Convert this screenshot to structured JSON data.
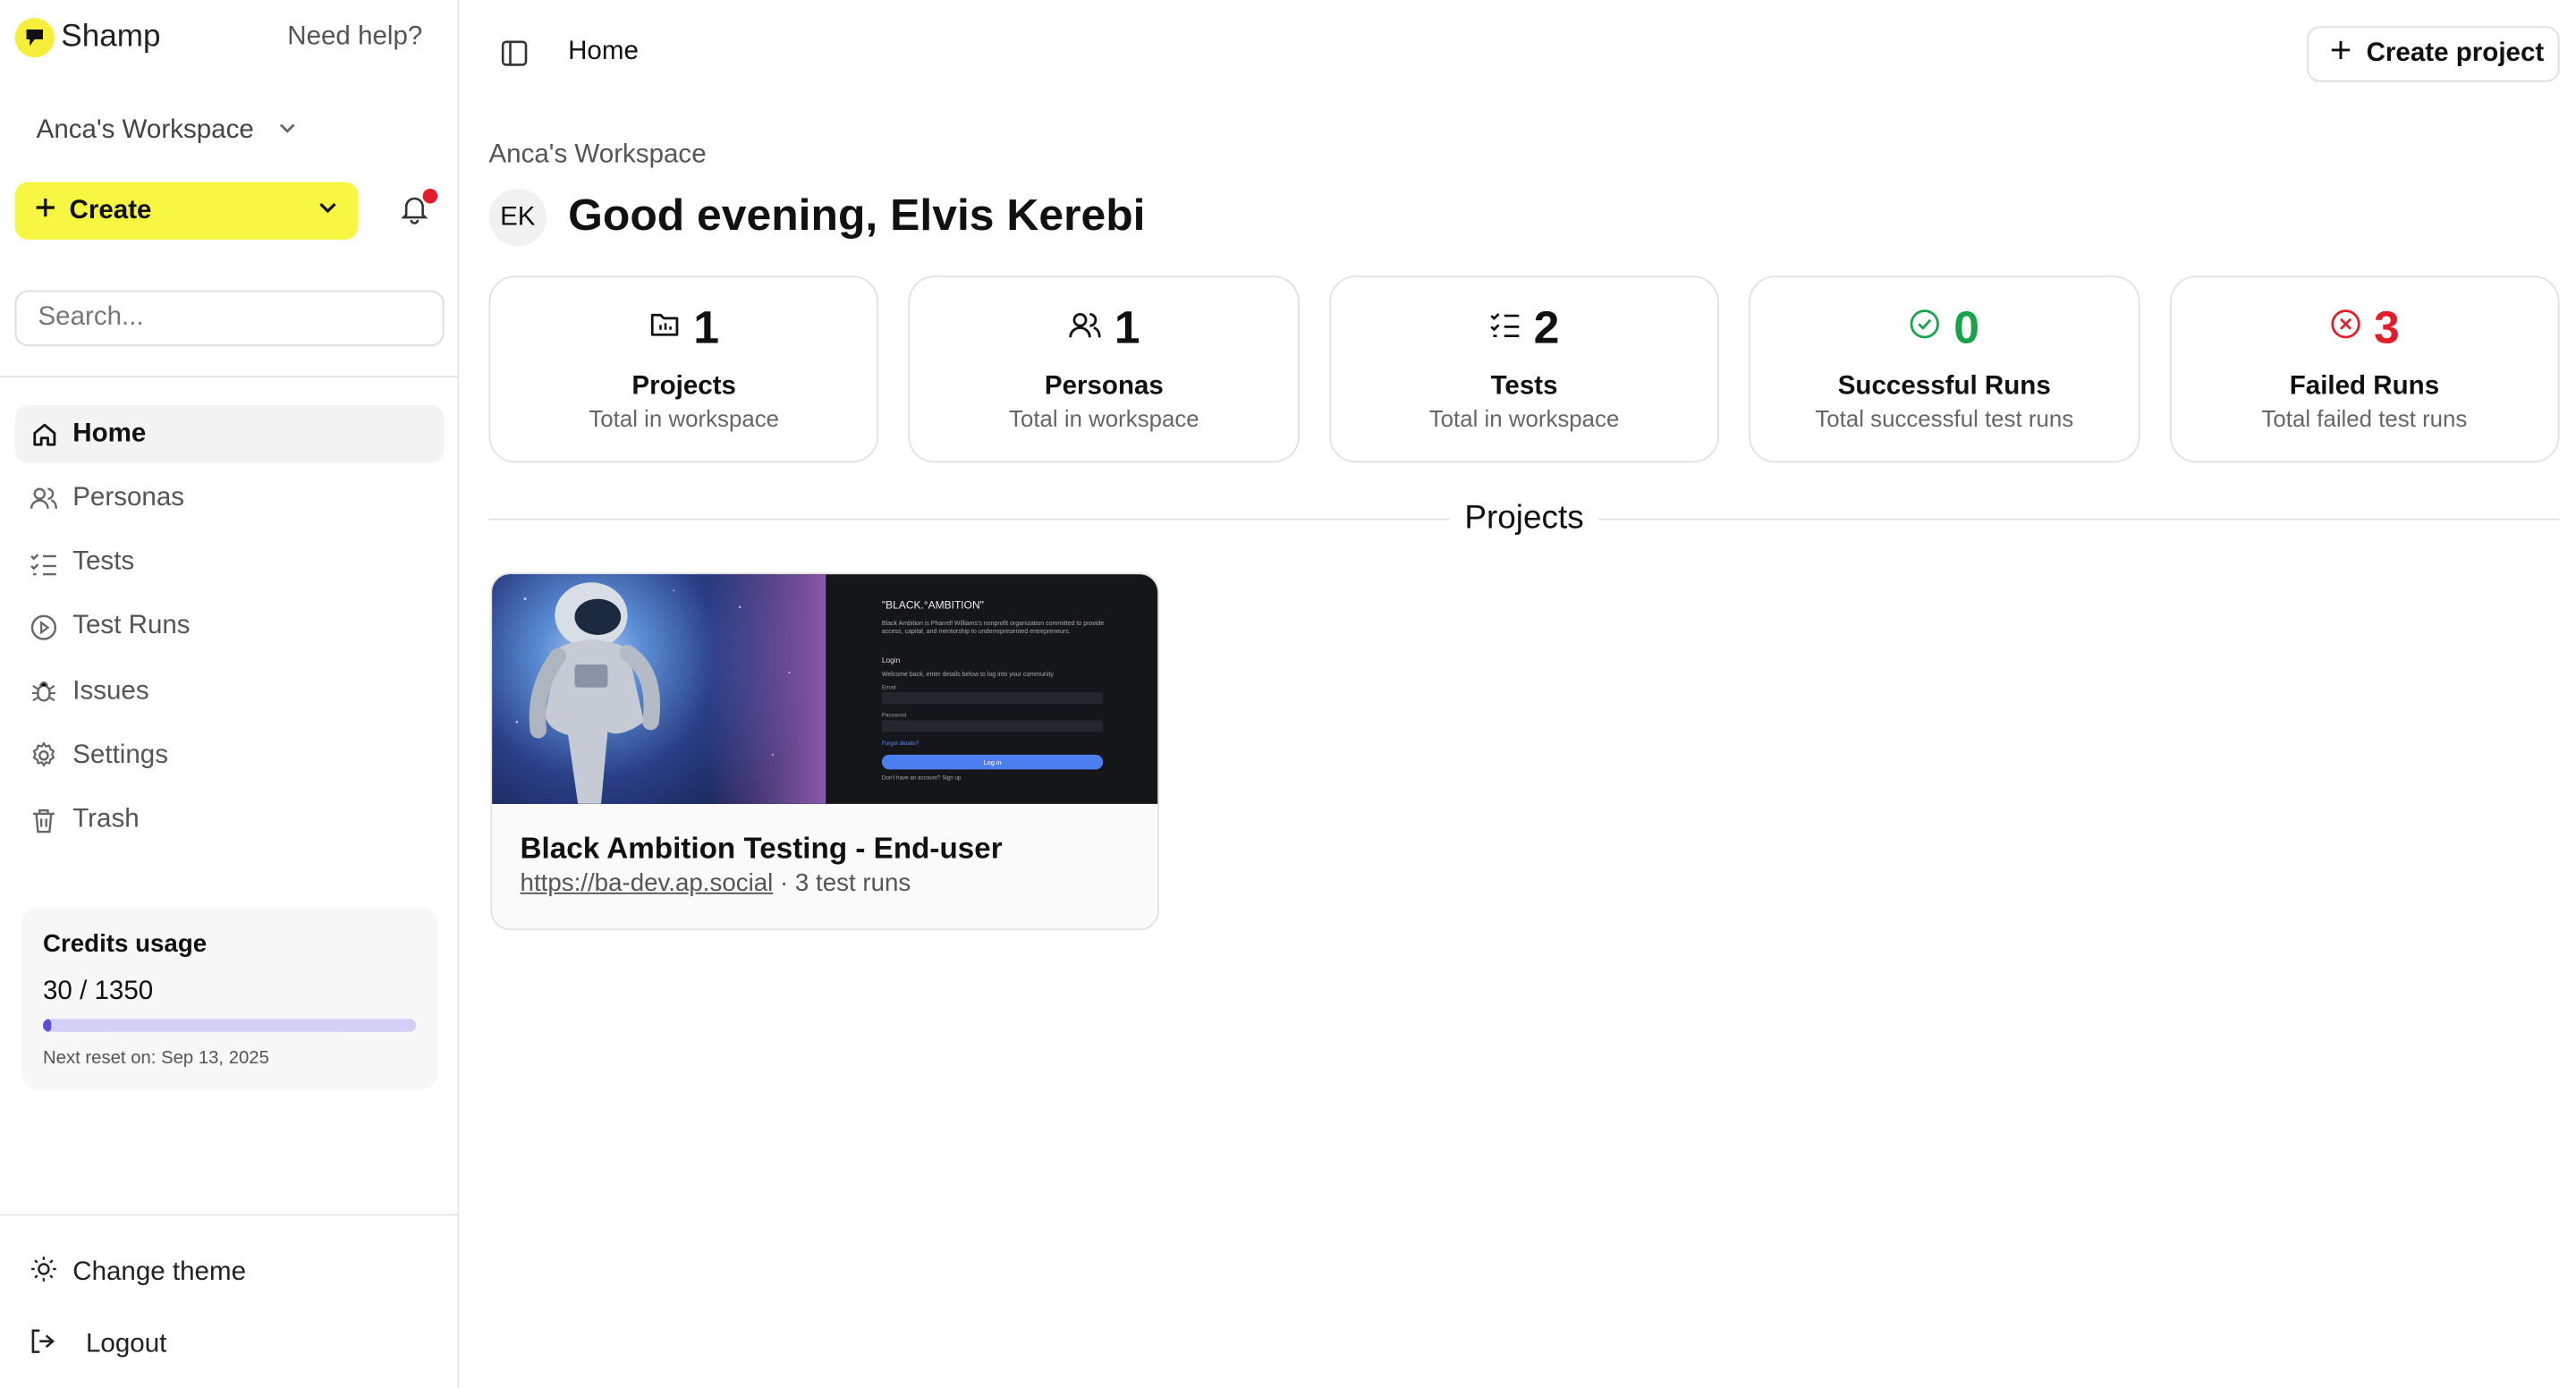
{
  "brand": {
    "name": "Shamp",
    "logo_color": "#f7ee3b"
  },
  "sidebar": {
    "need_help": "Need help?",
    "workspace": "Anca's Workspace",
    "create_label": "Create",
    "search_placeholder": "Search...",
    "nav": [
      {
        "label": "Home",
        "icon": "home-icon",
        "active": true
      },
      {
        "label": "Personas",
        "icon": "users-icon"
      },
      {
        "label": "Tests",
        "icon": "list-check-icon"
      },
      {
        "label": "Test Runs",
        "icon": "play-circle-icon"
      },
      {
        "label": "Issues",
        "icon": "bug-icon"
      },
      {
        "label": "Settings",
        "icon": "gear-icon"
      },
      {
        "label": "Trash",
        "icon": "trash-icon"
      }
    ],
    "credits": {
      "title": "Credits usage",
      "value": "30 / 1350",
      "fraction": 0.022,
      "reset": "Next reset on: Sep 13, 2025"
    },
    "change_theme": "Change theme",
    "logout": "Logout"
  },
  "header": {
    "breadcrumb": "Home",
    "create_project": "Create project"
  },
  "main": {
    "workspace_label": "Anca's Workspace",
    "avatar_initials": "EK",
    "greeting": "Good evening, Elvis Kerebi",
    "stats": [
      {
        "icon": "folder-icon",
        "value": "1",
        "label": "Projects",
        "sub": "Total in workspace",
        "color": "#111111"
      },
      {
        "icon": "users-icon",
        "value": "1",
        "label": "Personas",
        "sub": "Total in workspace",
        "color": "#111111"
      },
      {
        "icon": "list-check-icon",
        "value": "2",
        "label": "Tests",
        "sub": "Total in workspace",
        "color": "#111111"
      },
      {
        "icon": "check-circle-icon",
        "value": "0",
        "label": "Successful Runs",
        "sub": "Total successful test runs",
        "color": "#16a34a"
      },
      {
        "icon": "x-circle-icon",
        "value": "3",
        "label": "Failed Runs",
        "sub": "Total failed test runs",
        "color": "#e11d2a"
      }
    ],
    "projects_title": "Projects",
    "project": {
      "title": "Black Ambition Testing - End-user",
      "url": "https://ba-dev.ap.social",
      "runs": "· 3 test runs",
      "thumb": {
        "brand": "\"BLACK.°AMBITION\"",
        "desc": "Black Ambition is Pharrell Williams's nonprofit organization committed to provide access, capital, and mentorship to underrepresented entrepreneurs.",
        "login_title": "Login",
        "welcome": "Welcome back, enter details below to log into your community",
        "email_label": "Email",
        "password_label": "Password",
        "forgot": "Forgot details?",
        "button": "Log in",
        "signup": "Don't have an account? Sign up"
      }
    }
  }
}
